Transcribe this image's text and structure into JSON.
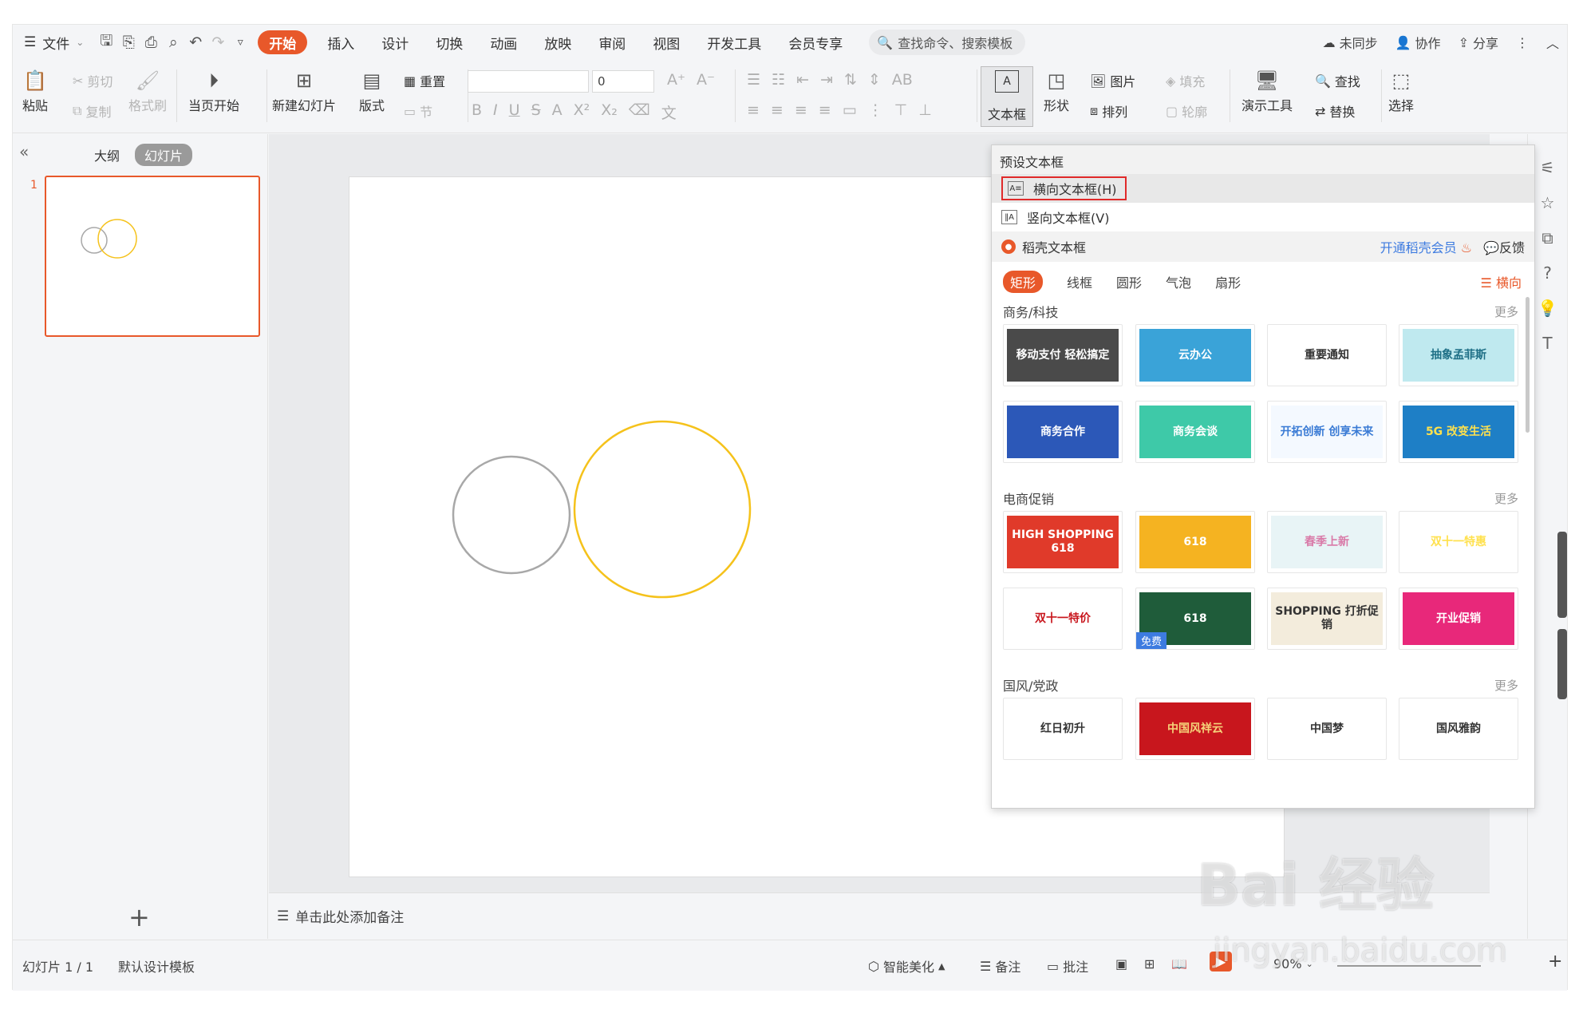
{
  "menubar": {
    "file_label": "文件",
    "tabs": [
      "开始",
      "插入",
      "设计",
      "切换",
      "动画",
      "放映",
      "审阅",
      "视图",
      "开发工具",
      "会员专享"
    ],
    "active_tab": "开始",
    "search_placeholder": "查找命令、搜索模板",
    "right": {
      "sync": "未同步",
      "collab": "协作",
      "share": "分享"
    }
  },
  "toolbar": {
    "paste": "粘贴",
    "cut": "剪切",
    "copy": "复制",
    "format_painter": "格式刷",
    "play_from_current": "当页开始",
    "new_slide": "新建幻灯片",
    "layout": "版式",
    "reset": "重置",
    "section": "节",
    "font_size": "0",
    "textbox": "文本框",
    "shape": "形状",
    "picture": "图片",
    "fill": "填充",
    "arrange": "排列",
    "outline": "轮廓",
    "presentation_tools": "演示工具",
    "find": "查找",
    "replace": "替换",
    "select": "选择"
  },
  "leftpanel": {
    "tab_outline": "大纲",
    "tab_slides": "幻灯片",
    "slide_number": "1",
    "add": "+"
  },
  "notes": {
    "placeholder": "单击此处添加备注"
  },
  "statusbar": {
    "slide_info": "幻灯片 1 / 1",
    "template": "默认设计模板",
    "smart_beautify": "智能美化",
    "notes": "备注",
    "comments": "批注",
    "zoom": "90%"
  },
  "dropdown": {
    "preset_header": "预设文本框",
    "horizontal": "横向文本框(H)",
    "vertical": "竖向文本框(V)",
    "docer": "稻壳文本框",
    "vip": "开通稻壳会员",
    "feedback": "反馈",
    "shape_tabs": [
      "矩形",
      "线框",
      "圆形",
      "气泡",
      "扇形"
    ],
    "orientation": "横向",
    "more": "更多",
    "categories": [
      {
        "title": "商务/科技",
        "templates": [
          {
            "text": "移动支付 轻松搞定",
            "bg": "#4a4a4a",
            "fg": "#ffffff"
          },
          {
            "text": "云办公",
            "bg": "#3aa3d8",
            "fg": "#ffffff"
          },
          {
            "text": "重要通知",
            "bg": "#ffffff",
            "fg": "#333333"
          },
          {
            "text": "抽象孟菲斯",
            "bg": "#bfe9ef",
            "fg": "#1e6f86"
          },
          {
            "text": "商务合作",
            "bg": "#2c58b8",
            "fg": "#ffffff"
          },
          {
            "text": "商务会谈",
            "bg": "#3ec9a8",
            "fg": "#ffffff"
          },
          {
            "text": "开拓创新 创享未来",
            "bg": "#f4f9ff",
            "fg": "#3a7bd5"
          },
          {
            "text": "5G 改变生活",
            "bg": "#1e7fc6",
            "fg": "#ffe14d"
          }
        ]
      },
      {
        "title": "电商促销",
        "templates": [
          {
            "text": "HIGH SHOPPING 618",
            "bg": "#e03a2a",
            "fg": "#ffffff"
          },
          {
            "text": "618",
            "bg": "#f5b321",
            "fg": "#ffffff"
          },
          {
            "text": "春季上新",
            "bg": "#e8f4f6",
            "fg": "#d97aa8"
          },
          {
            "text": "双十一特惠",
            "bg": "#ffffff",
            "fg": "#ffe14d"
          },
          {
            "text": "双十一特价",
            "bg": "#ffffff",
            "fg": "#c8161d"
          },
          {
            "text": "618",
            "bg": "#1f5c3a",
            "fg": "#ffffff"
          },
          {
            "text": "SHOPPING 打折促销",
            "bg": "#f3ecdc",
            "fg": "#333333"
          },
          {
            "text": "开业促销",
            "bg": "#ffffff",
            "fg": "#ffffff"
          }
        ],
        "free_badge": "免费"
      },
      {
        "title": "国风/党政",
        "templates": [
          {
            "text": "红日初升",
            "bg": "#ffffff",
            "fg": "#333333"
          },
          {
            "text": "中国风祥云",
            "bg": "#c8161d",
            "fg": "#f5d27a"
          },
          {
            "text": "中国梦",
            "bg": "#ffffff",
            "fg": "#333333"
          },
          {
            "text": "国风雅韵",
            "bg": "#ffffff",
            "fg": "#333333"
          }
        ]
      }
    ]
  },
  "watermark": {
    "main": "Bai 经验",
    "sub": "jingyan.baidu.com"
  },
  "colors": {
    "accent": "#e8582a",
    "highlight_border": "#e02a2a",
    "circle_gray": "#a8a8a8",
    "circle_yellow": "#f5c21b"
  }
}
